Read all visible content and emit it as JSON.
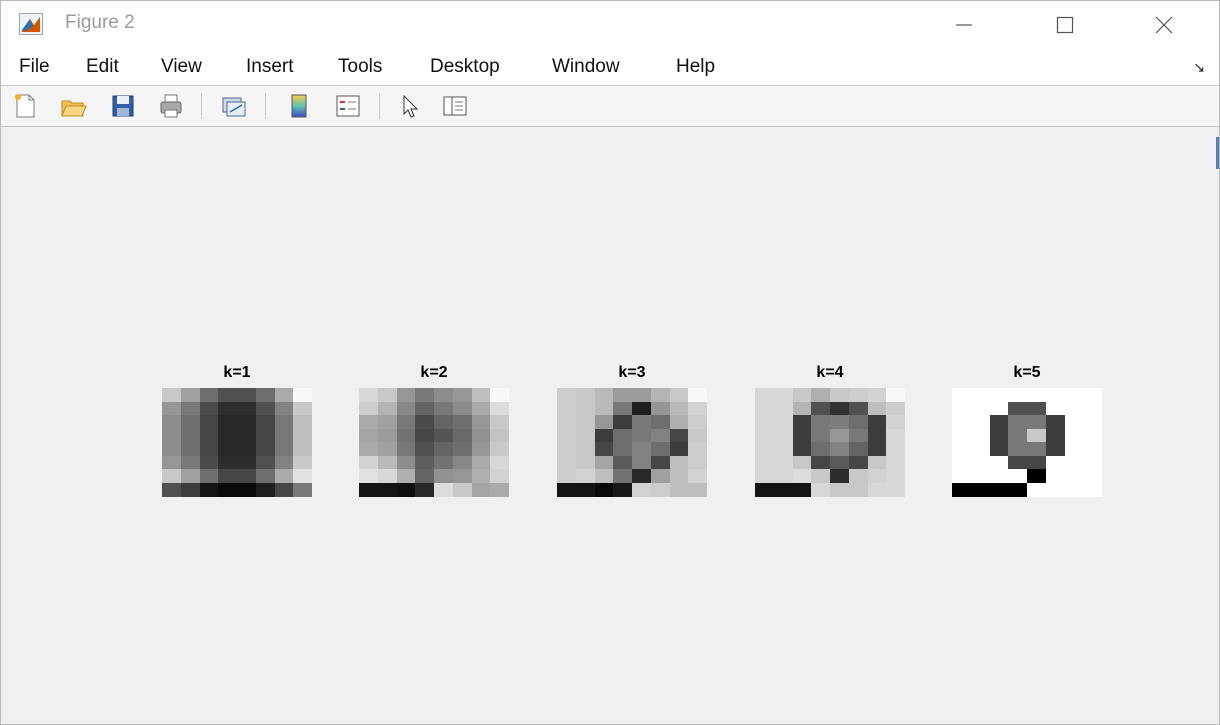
{
  "window": {
    "title": "Figure 2",
    "controls": {
      "minimize": "minimize-icon",
      "maximize": "maximize-icon",
      "close": "close-icon"
    }
  },
  "menu": [
    "File",
    "Edit",
    "View",
    "Insert",
    "Tools",
    "Desktop",
    "Window",
    "Help"
  ],
  "toolbar": [
    "new-figure-icon",
    "open-file-icon",
    "save-icon",
    "print-icon",
    "link-plot-icon",
    "insert-colorbar-icon",
    "insert-legend-icon",
    "edit-plot-arrow-icon",
    "property-inspector-icon"
  ],
  "figure": {
    "subplots": [
      {
        "title": "k=1",
        "cols": 8,
        "grid": [
          [
            200,
            160,
            110,
            80,
            80,
            110,
            170,
            248
          ],
          [
            150,
            120,
            75,
            45,
            45,
            80,
            130,
            200
          ],
          [
            140,
            110,
            70,
            40,
            40,
            70,
            120,
            190
          ],
          [
            140,
            110,
            70,
            40,
            40,
            70,
            120,
            190
          ],
          [
            140,
            110,
            70,
            40,
            40,
            70,
            120,
            190
          ],
          [
            150,
            120,
            75,
            45,
            45,
            80,
            130,
            200
          ],
          [
            200,
            160,
            110,
            70,
            70,
            110,
            170,
            225
          ],
          [
            80,
            60,
            20,
            10,
            10,
            30,
            70,
            120
          ]
        ]
      },
      {
        "title": "k=2",
        "cols": 8,
        "grid": [
          [
            215,
            200,
            150,
            120,
            140,
            150,
            190,
            248
          ],
          [
            205,
            180,
            135,
            100,
            120,
            140,
            170,
            220
          ],
          [
            170,
            160,
            120,
            75,
            100,
            110,
            150,
            200
          ],
          [
            165,
            155,
            115,
            70,
            85,
            105,
            145,
            195
          ],
          [
            170,
            160,
            120,
            80,
            100,
            110,
            150,
            200
          ],
          [
            210,
            185,
            140,
            95,
            115,
            135,
            170,
            215
          ],
          [
            225,
            215,
            175,
            100,
            145,
            150,
            175,
            210
          ],
          [
            20,
            20,
            15,
            40,
            220,
            200,
            165,
            170
          ]
        ]
      },
      {
        "title": "k=3",
        "cols": 8,
        "grid": [
          [
            205,
            200,
            185,
            155,
            155,
            180,
            200,
            248
          ],
          [
            205,
            200,
            185,
            120,
            30,
            150,
            185,
            210
          ],
          [
            205,
            200,
            150,
            60,
            120,
            110,
            175,
            205
          ],
          [
            205,
            200,
            60,
            110,
            120,
            130,
            70,
            200
          ],
          [
            205,
            200,
            70,
            110,
            130,
            110,
            60,
            205
          ],
          [
            205,
            200,
            165,
            90,
            130,
            70,
            190,
            205
          ],
          [
            205,
            210,
            190,
            115,
            40,
            160,
            190,
            210
          ],
          [
            20,
            20,
            10,
            25,
            210,
            205,
            190,
            190
          ]
        ]
      },
      {
        "title": "k=4",
        "cols": 8,
        "grid": [
          [
            215,
            215,
            200,
            175,
            200,
            205,
            210,
            248
          ],
          [
            215,
            215,
            180,
            80,
            50,
            80,
            190,
            205
          ],
          [
            215,
            215,
            60,
            120,
            125,
            110,
            60,
            210
          ],
          [
            215,
            215,
            60,
            120,
            150,
            120,
            60,
            215
          ],
          [
            215,
            215,
            60,
            110,
            130,
            100,
            60,
            215
          ],
          [
            215,
            215,
            200,
            70,
            90,
            70,
            200,
            215
          ],
          [
            215,
            215,
            220,
            200,
            45,
            200,
            210,
            215
          ],
          [
            20,
            20,
            20,
            215,
            200,
            200,
            215,
            215
          ]
        ]
      },
      {
        "title": "k=5",
        "cols": 8,
        "grid": [
          [
            255,
            255,
            255,
            255,
            255,
            255,
            255,
            255
          ],
          [
            255,
            255,
            255,
            80,
            80,
            255,
            255,
            255
          ],
          [
            255,
            255,
            60,
            120,
            120,
            60,
            255,
            255
          ],
          [
            255,
            255,
            60,
            120,
            200,
            60,
            255,
            255
          ],
          [
            255,
            255,
            60,
            120,
            120,
            60,
            255,
            255
          ],
          [
            255,
            255,
            255,
            70,
            70,
            255,
            255,
            255
          ],
          [
            255,
            255,
            255,
            255,
            0,
            255,
            255,
            255
          ],
          [
            0,
            0,
            0,
            0,
            255,
            255,
            255,
            255
          ]
        ]
      }
    ]
  }
}
